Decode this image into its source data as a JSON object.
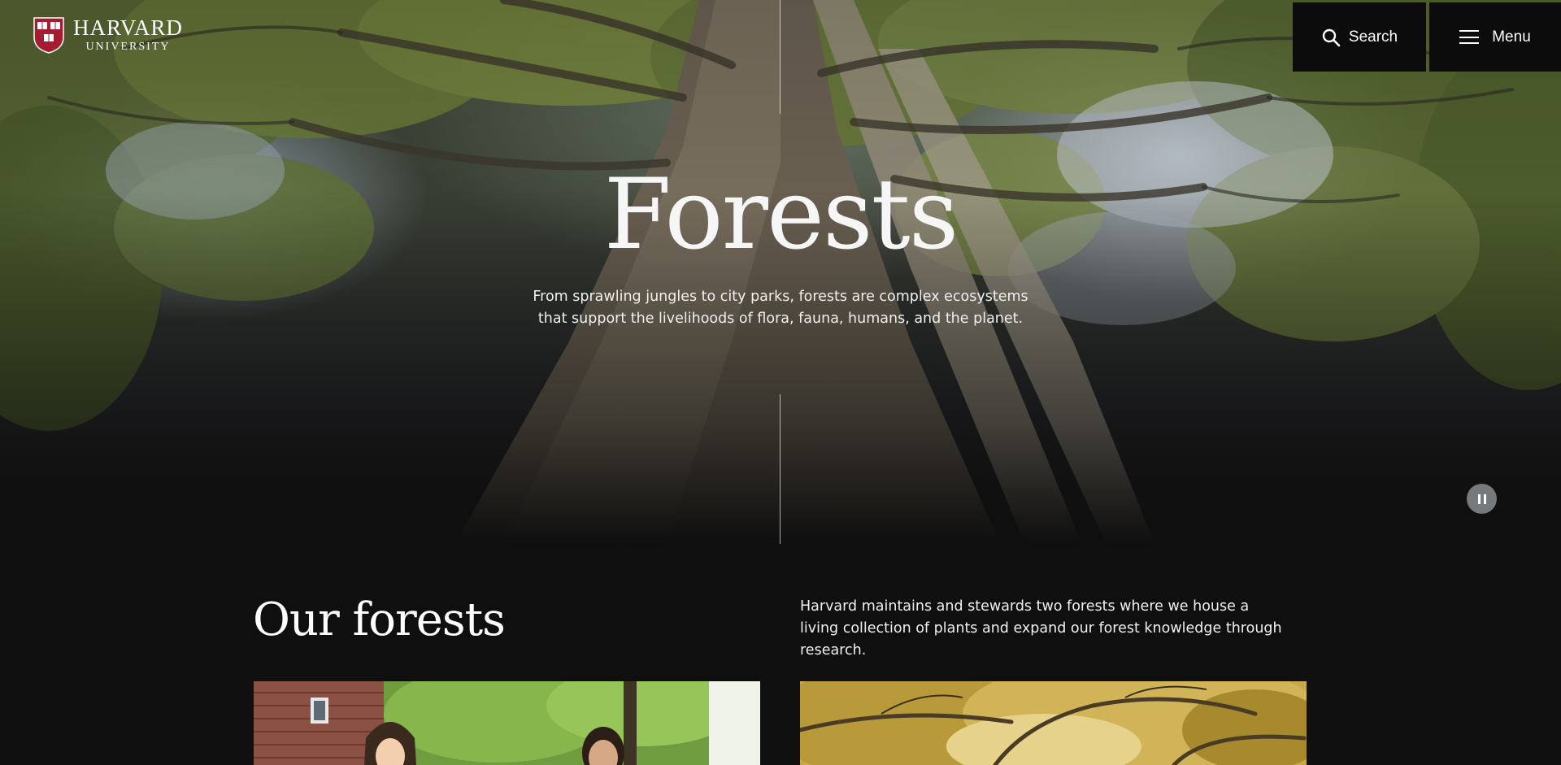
{
  "header": {
    "logo_word": "HARVARD",
    "logo_sub": "UNIVERSITY",
    "logo_aria": "Harvard University",
    "nav_links": [
      "",
      "",
      "",
      "",
      "",
      "",
      ""
    ],
    "search_placeholder": "",
    "search_label": "Search",
    "menu_label": "Menu"
  },
  "hero": {
    "title": "Forests",
    "description": "From sprawling jungles to city parks, forests are complex ecosystems that support the livelihoods of flora, fauna, humans, and the planet."
  },
  "section": {
    "title": "Our forests",
    "description": "Harvard maintains and stewards two forests where we house a living collection of plants and expand our forest knowledge through research.",
    "cards": [
      {
        "aria": "Learn more about Harvard Forest"
      },
      {
        "aria": "Learn more about the Arboretum"
      }
    ]
  },
  "colors": {
    "page_bg": "#0f0f0f",
    "header_button_bg": "#0c0c0c",
    "text": "#ffffff",
    "shield_red": "#a51c30"
  },
  "icons": [
    "harvard-shield-icon",
    "search-icon",
    "hamburger-icon",
    "pause-icon"
  ]
}
